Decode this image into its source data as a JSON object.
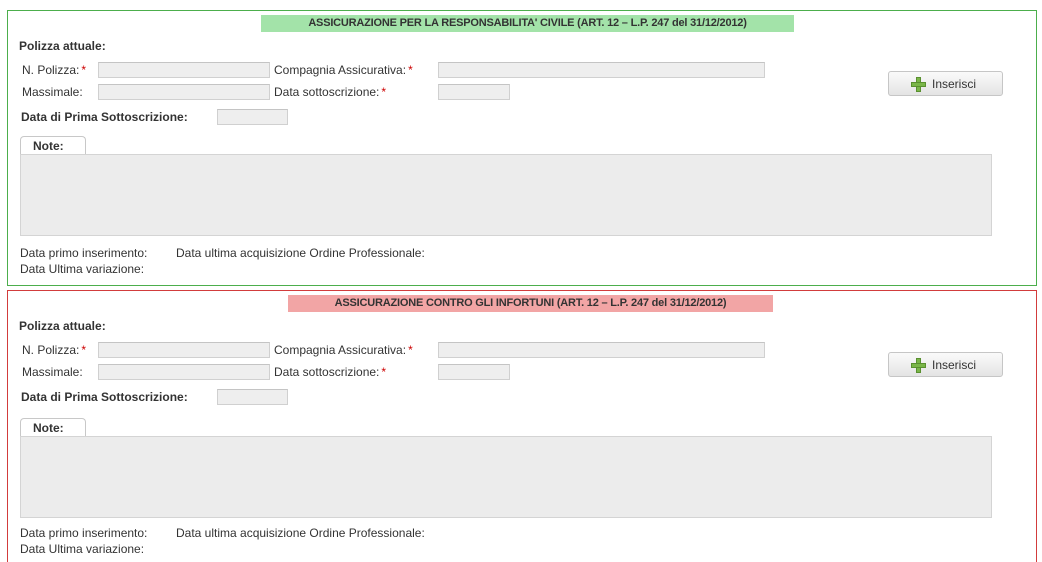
{
  "sections": [
    {
      "title": "ASSICURAZIONE PER LA RESPONSABILITA' CIVILE (ART. 12 – L.P. 247 del 31/12/2012)",
      "accent": "#4cae4c",
      "banner_color": "#a3e3a9",
      "polizza_heading": "Polizza attuale:",
      "n_polizza_label": "N. Polizza:",
      "compagnia_label": "Compagnia Assicurativa:",
      "massimale_label": "Massimale:",
      "data_sottoscrizione_label": "Data sottoscrizione:",
      "prima_sottoscrizione_label": "Data di Prima Sottoscrizione:",
      "insert_button": "Inserisci",
      "note_tab": "Note:",
      "data_primo_inserimento": "Data primo inserimento:",
      "data_ultima_acquisizione": "Data ultima acquisizione Ordine Professionale:",
      "data_ultima_variazione": "Data Ultima variazione:"
    },
    {
      "title": "ASSICURAZIONE CONTRO GLI INFORTUNI (ART. 12 – L.P. 247 del 31/12/2012)",
      "accent": "#d23c3c",
      "banner_color": "#f2a5a5",
      "polizza_heading": "Polizza attuale:",
      "n_polizza_label": "N. Polizza:",
      "compagnia_label": "Compagnia Assicurativa:",
      "massimale_label": "Massimale:",
      "data_sottoscrizione_label": "Data sottoscrizione:",
      "prima_sottoscrizione_label": "Data di Prima Sottoscrizione:",
      "insert_button": "Inserisci",
      "note_tab": "Note:",
      "data_primo_inserimento": "Data primo inserimento:",
      "data_ultima_acquisizione": "Data ultima acquisizione Ordine Professionale:",
      "data_ultima_variazione": "Data Ultima variazione:"
    }
  ],
  "required_marker": "*",
  "icons": {
    "insert": "plus-icon"
  }
}
